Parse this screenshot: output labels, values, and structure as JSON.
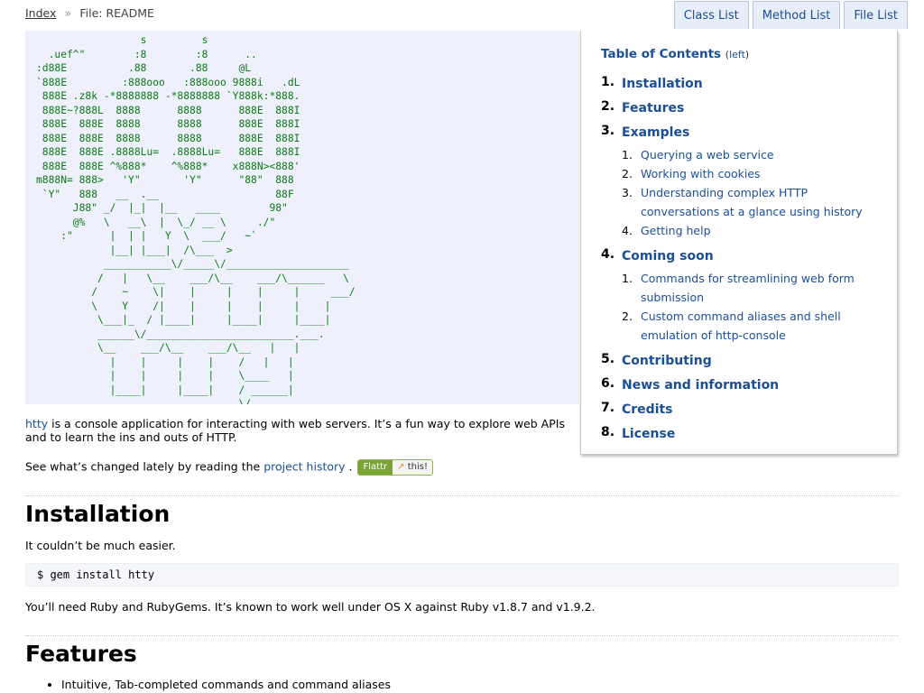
{
  "breadcrumb": {
    "index": "Index",
    "separator": "»",
    "current": "File: README"
  },
  "tabs": [
    "Class List",
    "Method List",
    "File List"
  ],
  "ascii_art": "                 s         s\n  .uef^\"        :8        :8      ..\n:d88E          .88       .88     @L\n`888E         :888ooo   :888ooo 9888i   .dL\n 888E .z8k -*8888888 -*8888888 `Y888k:*888.\n 888E~?888L  8888      8888      888E  888I\n 888E  888E  8888      8888      888E  888I\n 888E  888E  8888      8888      888E  888I\n 888E  888E .8888Lu=  .8888Lu=   888E  888I\n 888E  888E ^%888*    ^%888*    x888N><888'\nm888N= 888>   'Y\"       'Y\"      \"88\"  888\n `Y\"   888   __  .__                   88F\n      J88\" _/  |_|  |__   ____        98\"\n      @%   \\   __\\  |  \\_/ __ \\     ./\"\n    :\"      |  | |   Y  \\  ___/   ~`\n            |__| |___|  /\\___  >\n           ___________\\/_____\\/____________________\n          /   |   \\__    ___/\\__    ___/\\______   \\\n         /    ~    \\|    |     |    |     |     ___/\n         \\    Y    /|    |     |    |     |    |\n          \\___|_  / |____|     |____|     |____|\n          ______\\/________________________.___.\n          \\__    ___/\\__    ___/\\__   |   |\n            |    |     |    |    /   |   |\n            |    |     |    |    \\____   |\n            |____|     |____|    / ______|\n                                 \\/",
  "toc": {
    "title": "Table of Contents",
    "toggle_open": "(",
    "toggle_link": "left",
    "toggle_close": ")",
    "items": [
      {
        "num": "1.",
        "label": "Installation",
        "children": []
      },
      {
        "num": "2.",
        "label": "Features",
        "children": []
      },
      {
        "num": "3.",
        "label": "Examples",
        "children": [
          {
            "num": "1.",
            "label": "Querying a web service"
          },
          {
            "num": "2.",
            "label": "Working with cookies"
          },
          {
            "num": "3.",
            "label": "Understanding complex HTTP conversations at a glance using history"
          },
          {
            "num": "4.",
            "label": "Getting help"
          }
        ]
      },
      {
        "num": "4.",
        "label": "Coming soon",
        "children": [
          {
            "num": "1.",
            "label": "Commands for streamlining web form submission"
          },
          {
            "num": "2.",
            "label": "Custom command aliases and shell emulation of http-console"
          }
        ]
      },
      {
        "num": "5.",
        "label": "Contributing",
        "children": []
      },
      {
        "num": "6.",
        "label": "News and information",
        "children": []
      },
      {
        "num": "7.",
        "label": "Credits",
        "children": []
      },
      {
        "num": "8.",
        "label": "License",
        "children": []
      }
    ]
  },
  "intro": {
    "link": "htty",
    "text": " is a console application for interacting with web servers. It’s a fun way to explore web APIs and to learn the ins and outs of HTTP."
  },
  "history": {
    "before": "See what’s changed lately by reading the ",
    "link": "project history",
    "after": " ."
  },
  "flattr": {
    "left": "Flattr",
    "right": "this!",
    "icon": "↗"
  },
  "installation": {
    "heading": "Installation",
    "lead": "It couldn’t be much easier.",
    "code": "$ gem install htty",
    "note": "You’ll need Ruby and RubyGems. It’s known to work well under OS X against Ruby v1.8.7 and v1.9.2."
  },
  "features": {
    "heading": "Features",
    "items": [
      "Intuitive, Tab-completed commands and command aliases"
    ]
  },
  "colors": {
    "link": "#1a4f98",
    "ascii": "#0e7a14",
    "ascii_bg": "#eef1fb"
  }
}
